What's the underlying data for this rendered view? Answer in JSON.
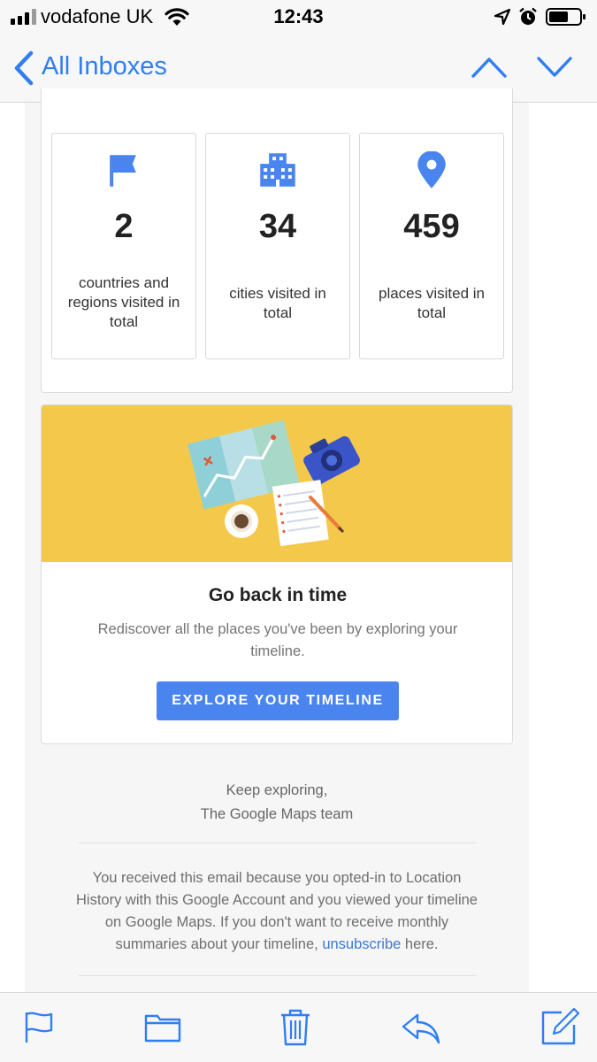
{
  "status_bar": {
    "carrier": "vodafone UK",
    "time": "12:43",
    "icons": [
      "signal-icon",
      "wifi-icon",
      "location-arrow-icon",
      "alarm-icon",
      "battery-icon"
    ]
  },
  "nav": {
    "back_label": "All Inboxes",
    "icons": [
      "chevron-left-icon",
      "chevron-up-icon",
      "chevron-down-icon"
    ]
  },
  "stats": [
    {
      "icon": "flag-icon",
      "number": "2",
      "label": "countries and regions visited in total"
    },
    {
      "icon": "city-icon",
      "number": "34",
      "label": "cities visited in total"
    },
    {
      "icon": "place-pin-icon",
      "number": "459",
      "label": "places visited in total"
    }
  ],
  "promo": {
    "illustration": "map-camera-notes-illustration",
    "title": "Go back in time",
    "description": "Rediscover all the places you've been by exploring your timeline.",
    "button_label": "EXPLORE YOUR TIMELINE"
  },
  "signoff": {
    "line1": "Keep exploring,",
    "line2": "The Google Maps team"
  },
  "footer": {
    "text_before": "You received this email because you opted-in to Location History with this Google Account and you viewed your timeline on Google Maps. If you don't want to receive monthly summaries about your timeline, ",
    "link_text": "unsubscribe",
    "text_after": " here."
  },
  "toolbar": {
    "icons": [
      "flag-icon",
      "folder-icon",
      "trash-icon",
      "reply-icon",
      "compose-icon"
    ]
  },
  "colors": {
    "ios_blue": "#2f7ef2",
    "google_blue": "#4a85ef",
    "banner_yellow": "#f4c84a"
  }
}
